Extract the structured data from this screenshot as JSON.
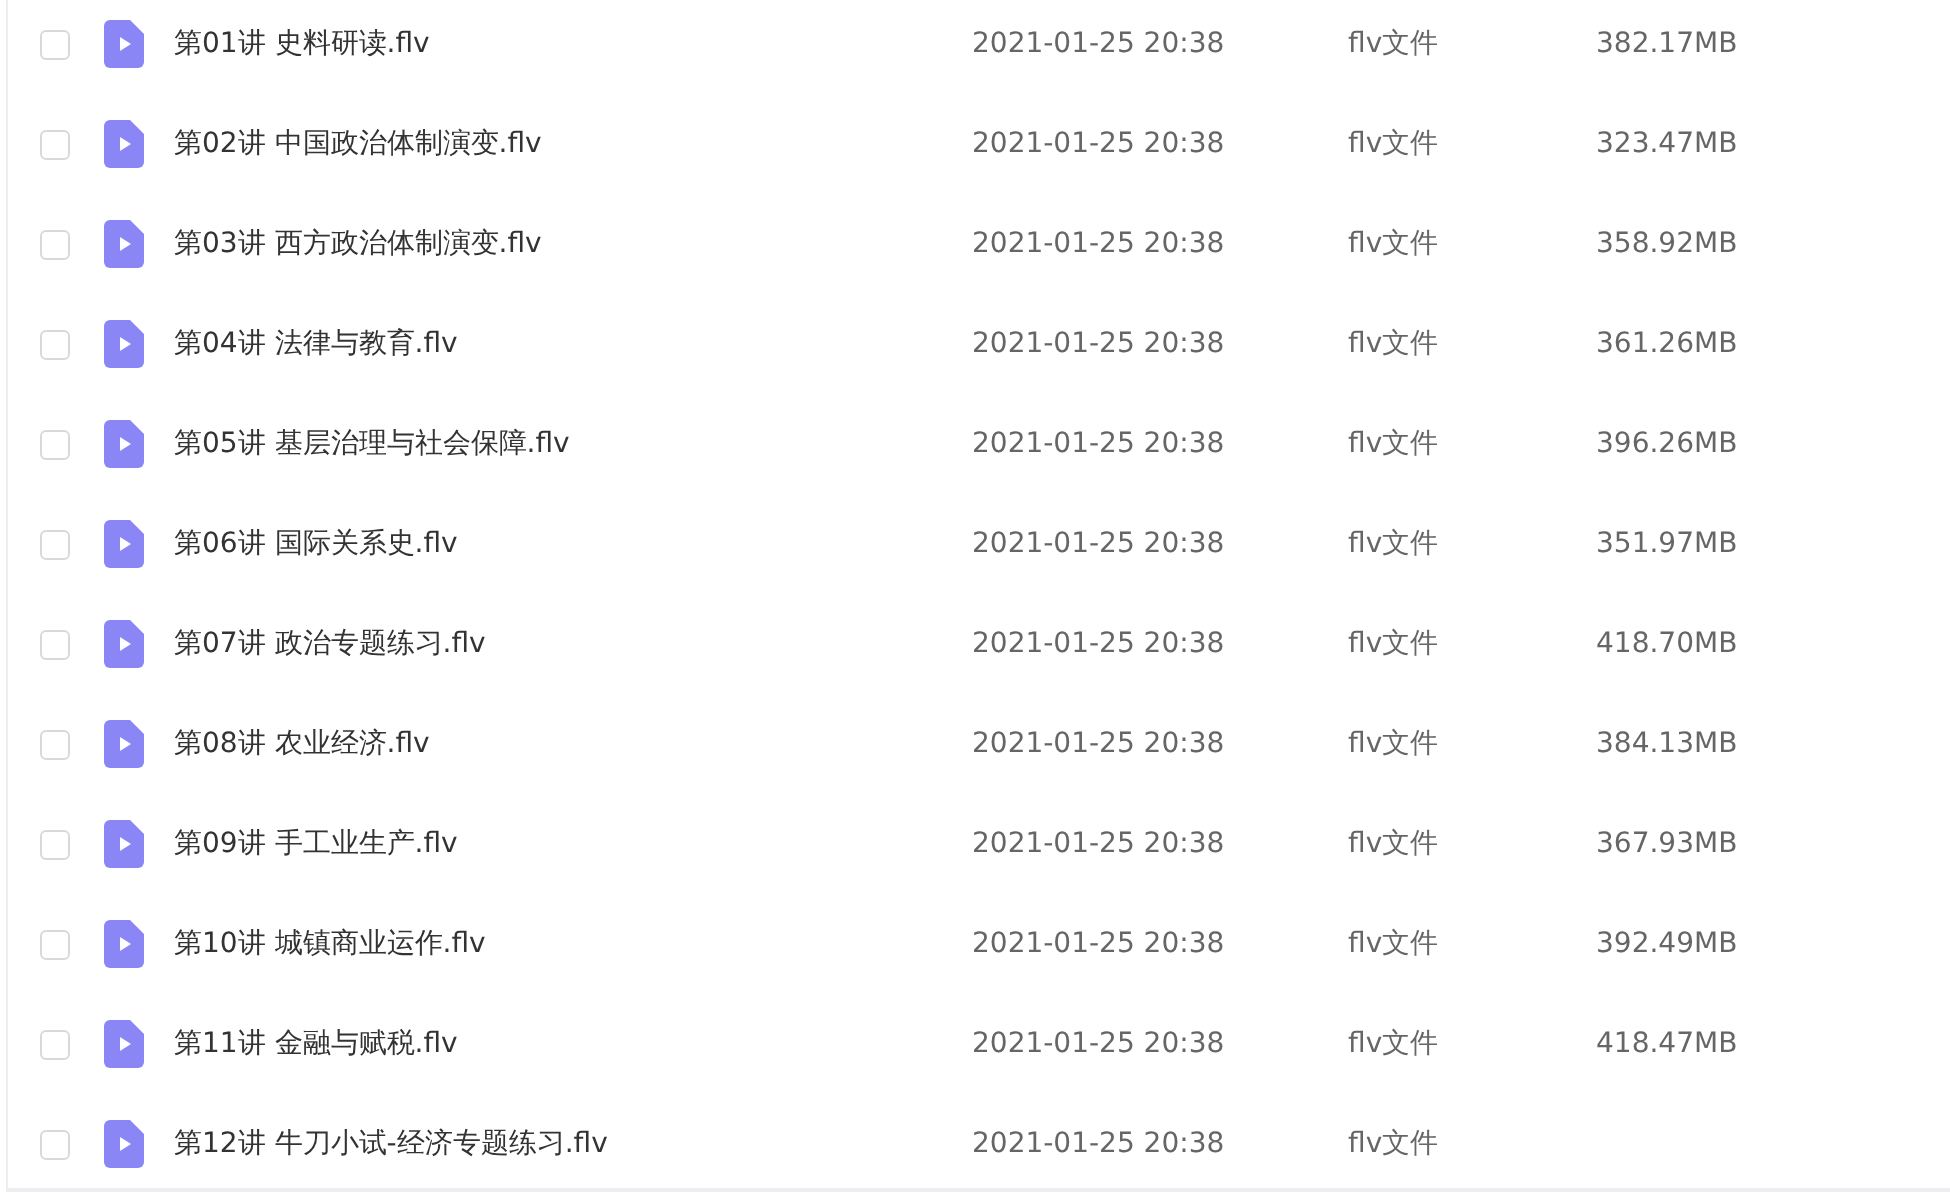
{
  "files": [
    {
      "name": "第01讲 史料研读.flv",
      "date": "2021-01-25 20:38",
      "type": "flv文件",
      "size": "382.17MB",
      "checked": false
    },
    {
      "name": "第02讲 中国政治体制演变.flv",
      "date": "2021-01-25 20:38",
      "type": "flv文件",
      "size": "323.47MB",
      "checked": false
    },
    {
      "name": "第03讲 西方政治体制演变.flv",
      "date": "2021-01-25 20:38",
      "type": "flv文件",
      "size": "358.92MB",
      "checked": false
    },
    {
      "name": "第04讲 法律与教育.flv",
      "date": "2021-01-25 20:38",
      "type": "flv文件",
      "size": "361.26MB",
      "checked": false
    },
    {
      "name": "第05讲 基层治理与社会保障.flv",
      "date": "2021-01-25 20:38",
      "type": "flv文件",
      "size": "396.26MB",
      "checked": false
    },
    {
      "name": "第06讲 国际关系史.flv",
      "date": "2021-01-25 20:38",
      "type": "flv文件",
      "size": "351.97MB",
      "checked": false
    },
    {
      "name": "第07讲 政治专题练习.flv",
      "date": "2021-01-25 20:38",
      "type": "flv文件",
      "size": "418.70MB",
      "checked": false
    },
    {
      "name": "第08讲 农业经济.flv",
      "date": "2021-01-25 20:38",
      "type": "flv文件",
      "size": "384.13MB",
      "checked": false
    },
    {
      "name": "第09讲 手工业生产.flv",
      "date": "2021-01-25 20:38",
      "type": "flv文件",
      "size": "367.93MB",
      "checked": false
    },
    {
      "name": "第10讲 城镇商业运作.flv",
      "date": "2021-01-25 20:38",
      "type": "flv文件",
      "size": "392.49MB",
      "checked": false
    },
    {
      "name": "第11讲 金融与赋税.flv",
      "date": "2021-01-25 20:38",
      "type": "flv文件",
      "size": "418.47MB",
      "checked": false
    },
    {
      "name": "第12讲 牛刀小试-经济专题练习.flv",
      "date": "2021-01-25 20:38",
      "type": "flv文件",
      "checked": false
    }
  ]
}
